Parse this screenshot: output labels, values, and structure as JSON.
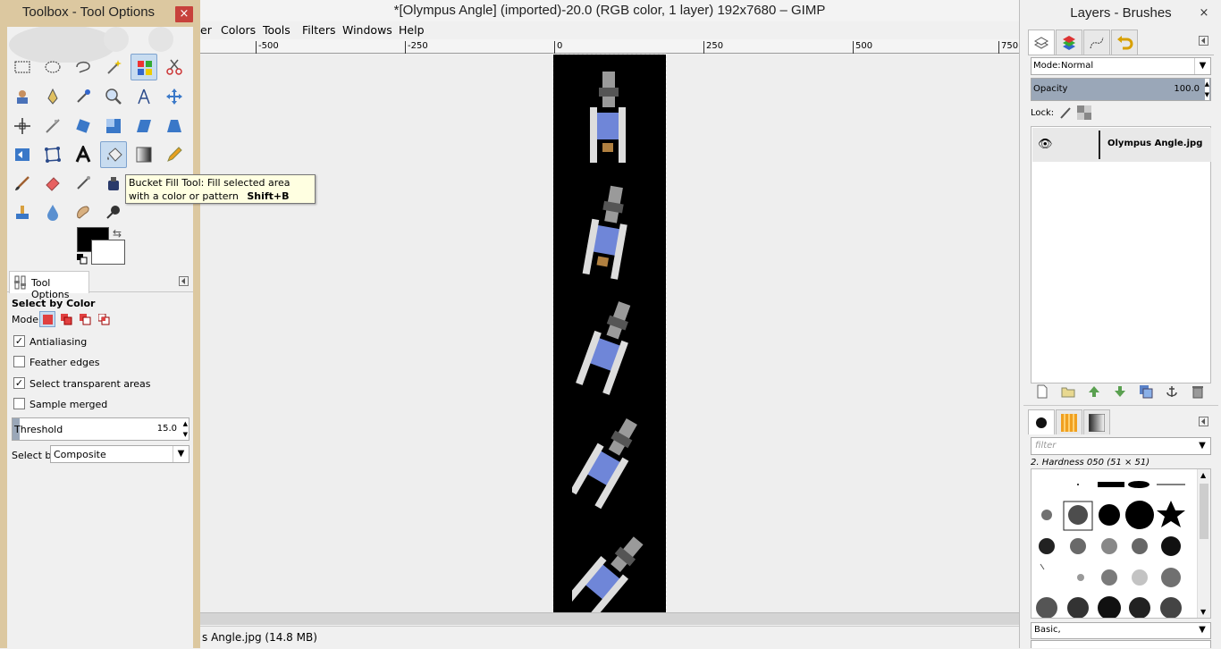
{
  "main": {
    "title": "*[Olympus Angle] (imported)-20.0 (RGB color, 1 layer) 192x7680 – GIMP",
    "menu": [
      "er",
      "Colors",
      "Tools",
      "Filters",
      "Windows",
      "Help"
    ],
    "ruler_ticks": [
      "-500",
      "-250",
      "0",
      "250",
      "500",
      "750"
    ],
    "status": "s Angle.jpg (14.8 MB)"
  },
  "toolbox": {
    "title": "Toolbox - Tool Options",
    "close": "×",
    "tooltip": {
      "text": "Bucket Fill Tool: Fill selected area with a color or pattern",
      "shortcut": "Shift+B"
    },
    "tool_options": {
      "tab_label": "Tool Options",
      "section_title": "Select by Color",
      "mode_label": "Mode:",
      "options": [
        {
          "label": "Antialiasing",
          "checked": true
        },
        {
          "label": "Feather edges",
          "checked": false
        },
        {
          "label": "Select transparent areas",
          "checked": true
        },
        {
          "label": "Sample merged",
          "checked": false
        }
      ],
      "threshold_label": "Threshold",
      "threshold_value": "15.0",
      "select_by_label": "Select by:",
      "select_by_value": "Composite"
    }
  },
  "dock": {
    "title": "Layers - Brushes",
    "close": "×",
    "mode_label": "Mode:",
    "mode_value": "Normal",
    "opacity_label": "Opacity",
    "opacity_value": "100.0",
    "lock_label": "Lock:",
    "layer_name": "Olympus Angle.jpg",
    "brush_filter_placeholder": "filter",
    "brush_name": "2. Hardness 050 (51 × 51)",
    "brush_tag_value": "Basic,"
  },
  "colors": {
    "toolbox_frame": "#dcc8a0",
    "close_red": "#c7413b",
    "tooltip_bg": "#ffffe1",
    "selection_highlight": "#c8dcf0"
  }
}
